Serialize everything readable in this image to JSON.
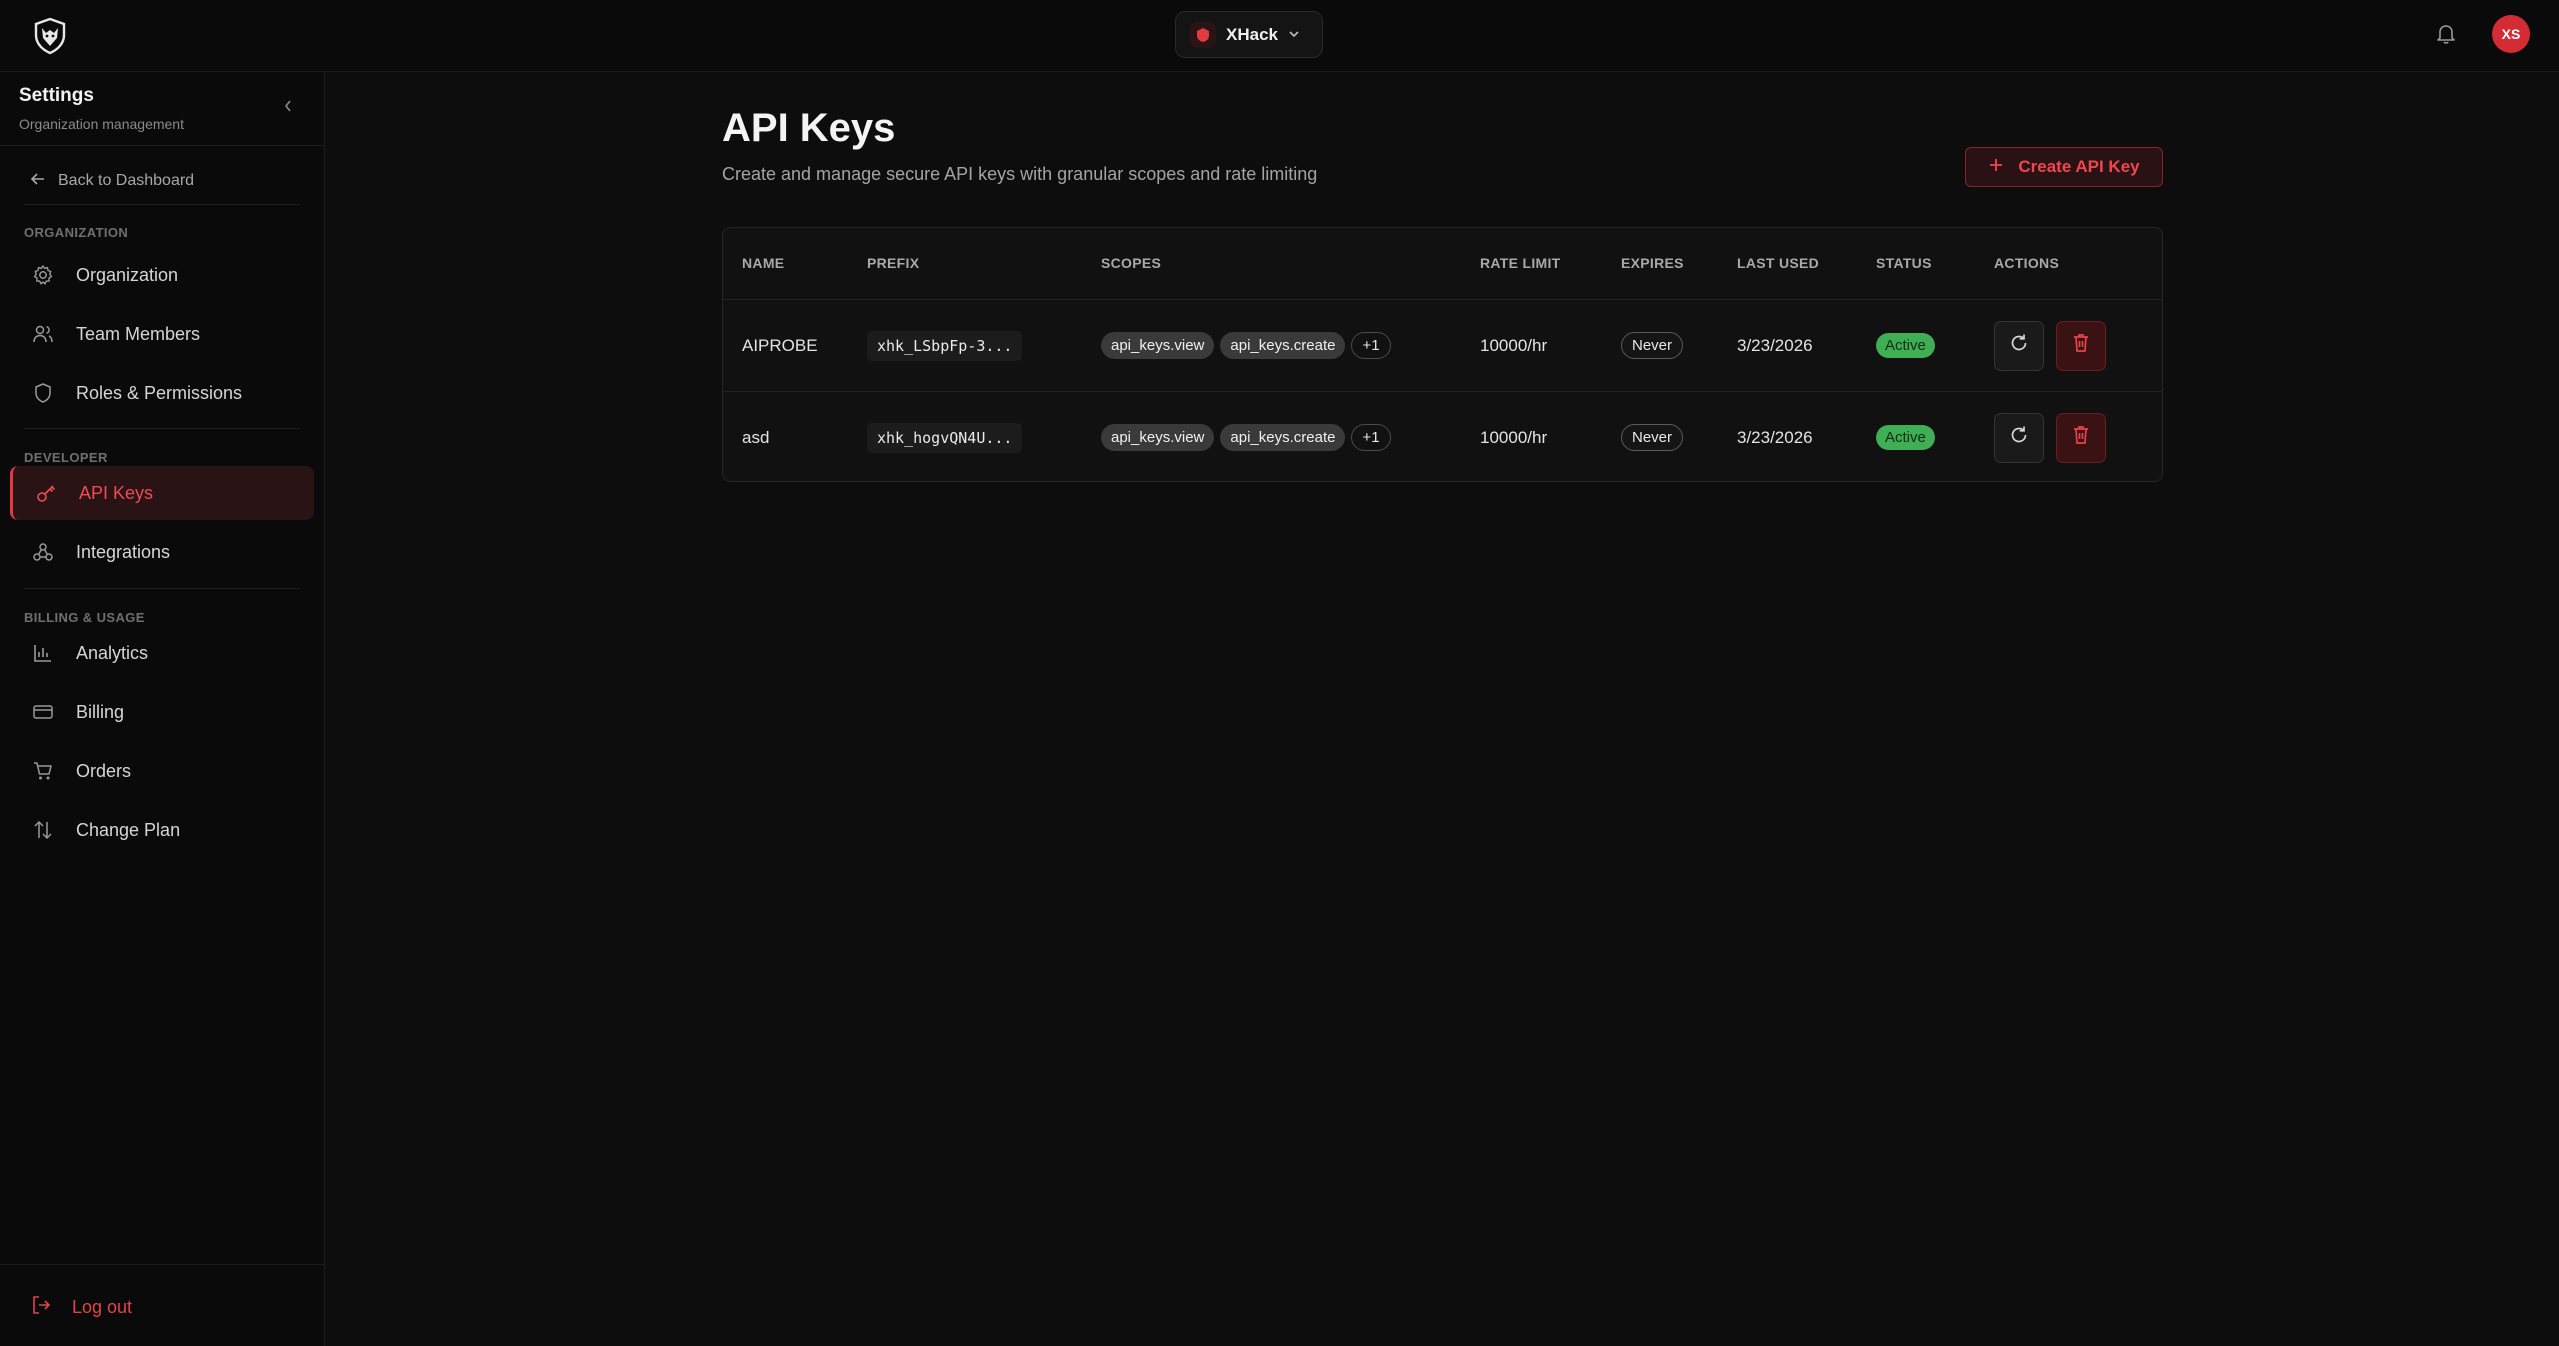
{
  "header": {
    "org_name": "XHack",
    "avatar_initials": "XS"
  },
  "sidebar": {
    "title": "Settings",
    "subtitle": "Organization management",
    "back_label": "Back to Dashboard",
    "sections": [
      {
        "label": "ORGANIZATION",
        "items": [
          {
            "label": "Organization",
            "icon": "gear-icon"
          },
          {
            "label": "Team Members",
            "icon": "users-icon"
          },
          {
            "label": "Roles & Permissions",
            "icon": "shield-icon"
          }
        ]
      },
      {
        "label": "DEVELOPER",
        "items": [
          {
            "label": "API Keys",
            "icon": "key-icon",
            "active": true
          },
          {
            "label": "Integrations",
            "icon": "webhook-icon"
          }
        ]
      },
      {
        "label": "BILLING & USAGE",
        "items": [
          {
            "label": "Analytics",
            "icon": "bar-chart-icon"
          },
          {
            "label": "Billing",
            "icon": "credit-card-icon"
          },
          {
            "label": "Orders",
            "icon": "cart-icon"
          },
          {
            "label": "Change Plan",
            "icon": "arrows-up-down-icon"
          }
        ]
      }
    ],
    "logout_label": "Log out"
  },
  "main": {
    "title": "API Keys",
    "subtitle": "Create and manage secure API keys with granular scopes and rate limiting",
    "create_label": "Create API Key",
    "table": {
      "columns": [
        "NAME",
        "PREFIX",
        "SCOPES",
        "RATE LIMIT",
        "EXPIRES",
        "LAST USED",
        "STATUS",
        "ACTIONS"
      ],
      "rows": [
        {
          "name": "AIPROBE",
          "prefix": "xhk_LSbpFp-3...",
          "scopes": [
            "api_keys.view",
            "api_keys.create"
          ],
          "scopes_more": "+1",
          "rate_limit": "10000/hr",
          "expires": "Never",
          "last_used": "3/23/2026",
          "status": "Active"
        },
        {
          "name": "asd",
          "prefix": "xhk_hogvQN4U...",
          "scopes": [
            "api_keys.view",
            "api_keys.create"
          ],
          "scopes_more": "+1",
          "rate_limit": "10000/hr",
          "expires": "Never",
          "last_used": "3/23/2026",
          "status": "Active"
        }
      ]
    }
  },
  "colors": {
    "accent": "#e03a42",
    "status_active": "#3fae54",
    "background": "#0d0d0d"
  }
}
